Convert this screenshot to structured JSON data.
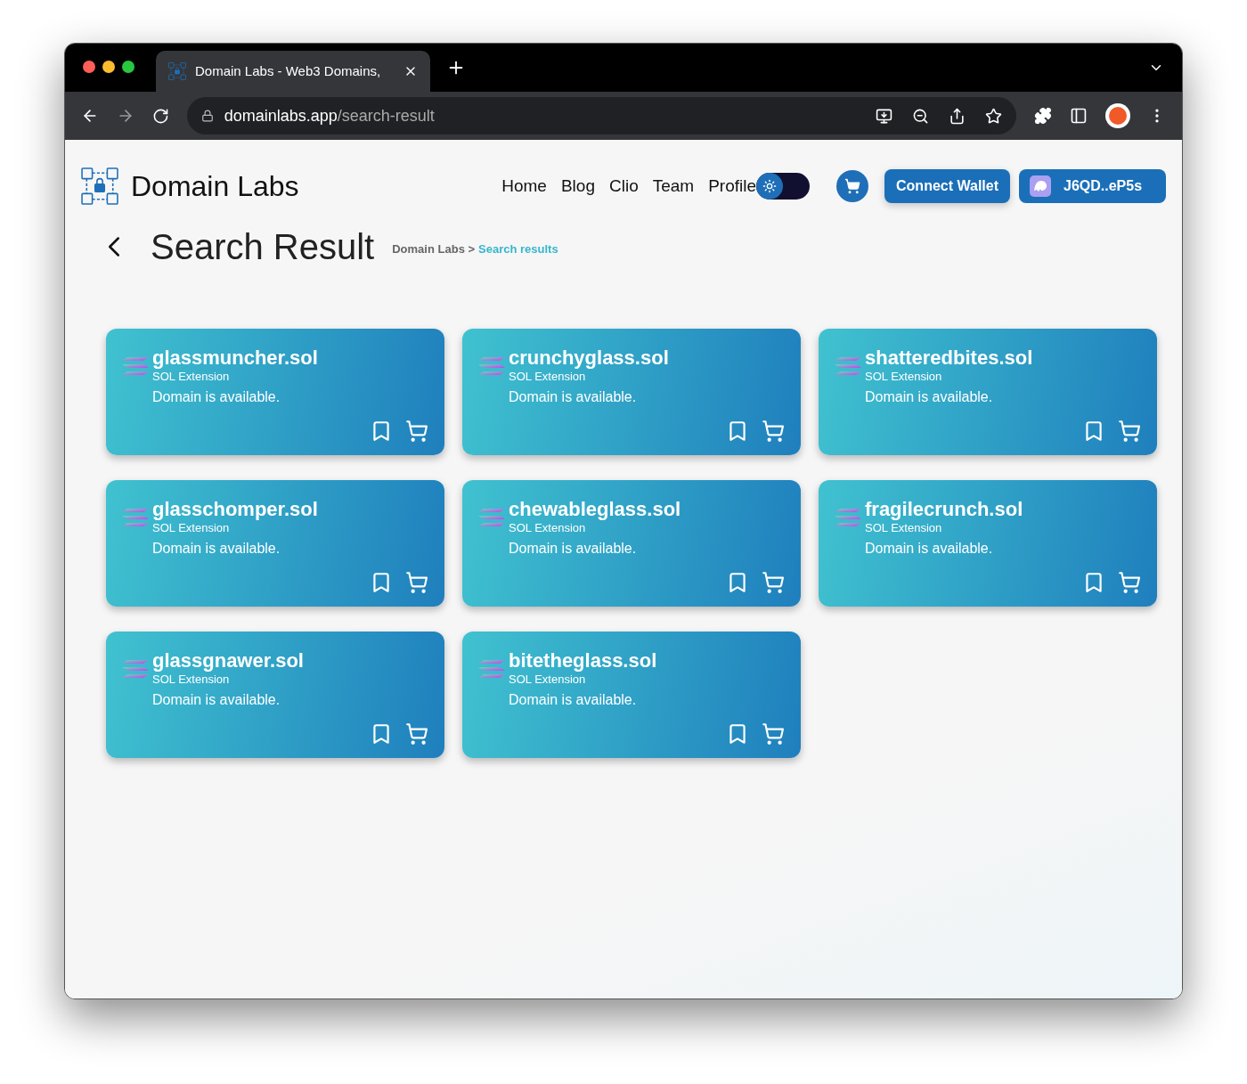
{
  "browser": {
    "tab_title": "Domain Labs - Web3 Domains,",
    "url_host": "domainlabs.app",
    "url_path": "/search-result"
  },
  "header": {
    "brand": "Domain Labs",
    "nav": [
      "Home",
      "Blog",
      "Clio",
      "Team",
      "Profile"
    ],
    "theme_toggle": {
      "dark": false
    },
    "connect_button": "Connect Wallet",
    "wallet_button": "J6QD..eP5s"
  },
  "page": {
    "title": "Search Result",
    "breadcrumb": [
      {
        "label": "Domain Labs >",
        "selected": false
      },
      {
        "label": "Search results",
        "selected": true
      }
    ]
  },
  "results": [
    {
      "domain": "glassmuncher.sol",
      "extension": "SOL Extension",
      "status": "Domain is available."
    },
    {
      "domain": "crunchyglass.sol",
      "extension": "SOL Extension",
      "status": "Domain is available."
    },
    {
      "domain": "shatteredbites.sol",
      "extension": "SOL Extension",
      "status": "Domain is available."
    },
    {
      "domain": "glasschomper.sol",
      "extension": "SOL Extension",
      "status": "Domain is available."
    },
    {
      "domain": "chewableglass.sol",
      "extension": "SOL Extension",
      "status": "Domain is available."
    },
    {
      "domain": "fragilecrunch.sol",
      "extension": "SOL Extension",
      "status": "Domain is available."
    },
    {
      "domain": "glassgnawer.sol",
      "extension": "SOL Extension",
      "status": "Domain is available."
    },
    {
      "domain": "bitetheglass.sol",
      "extension": "SOL Extension",
      "status": "Domain is available."
    }
  ]
}
